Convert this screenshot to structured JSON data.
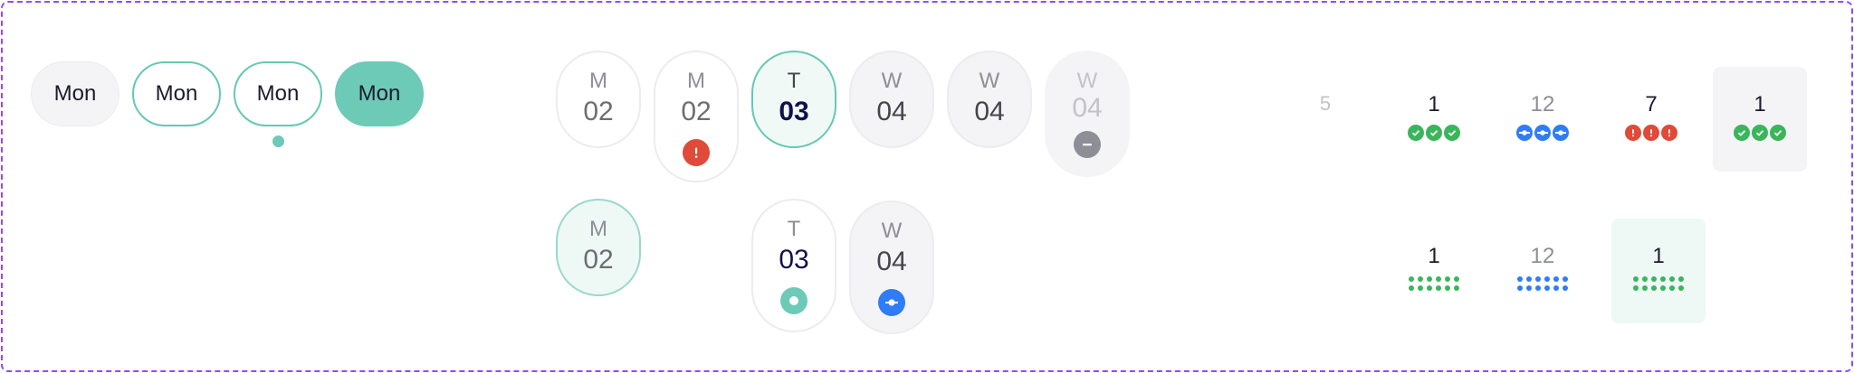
{
  "day_chips": [
    {
      "label": "Mon",
      "state": "default"
    },
    {
      "label": "Mon",
      "state": "outline"
    },
    {
      "label": "Mon",
      "state": "outline-with-dot"
    },
    {
      "label": "Mon",
      "state": "filled"
    }
  ],
  "date_pills": [
    {
      "weekday": "M",
      "day": "02",
      "state": "default"
    },
    {
      "weekday": "M",
      "day": "02",
      "state": "error",
      "badge_icon": "exclamation-icon"
    },
    {
      "weekday": "T",
      "day": "03",
      "state": "today"
    },
    {
      "weekday": "W",
      "day": "04",
      "state": "grey"
    },
    {
      "weekday": "W",
      "day": "04",
      "state": "grey"
    },
    {
      "weekday": "W",
      "day": "04",
      "state": "disabled",
      "badge_icon": "minus-icon"
    },
    {
      "weekday": "M",
      "day": "02",
      "state": "selected-mint"
    },
    {
      "weekday": "T",
      "day": "03",
      "state": "white",
      "badge_icon": "ring-icon"
    },
    {
      "weekday": "W",
      "day": "04",
      "state": "grey",
      "badge_icon": "commit-icon"
    }
  ],
  "month_cells": [
    {
      "number": "5",
      "state": "faded"
    },
    {
      "number": "1",
      "marks": "check",
      "count": 3,
      "color": "#3bb55c"
    },
    {
      "number": "12",
      "muted": true,
      "marks": "commit",
      "count": 3,
      "color": "#2f7cf6"
    },
    {
      "number": "7",
      "marks": "alert",
      "count": 3,
      "color": "#e04a38"
    },
    {
      "number": "1",
      "marks": "check",
      "count": 3,
      "color": "#3bb55c",
      "state": "grey-bg"
    },
    {
      "number": "1",
      "marks": "dots",
      "count": 12,
      "color": "#3bb55c"
    },
    {
      "number": "12",
      "muted": true,
      "marks": "dots",
      "count": 12,
      "color": "#2f7cf6"
    },
    {
      "number": "1",
      "marks": "dots",
      "count": 12,
      "color": "#3bb55c",
      "state": "mint-bg"
    }
  ],
  "colors": {
    "accent_teal": "#6ccab7",
    "outline_teal": "#65c8b4",
    "success": "#3bb55c",
    "info": "#2f7cf6",
    "error": "#e04a38",
    "frame": "#9747ff"
  }
}
